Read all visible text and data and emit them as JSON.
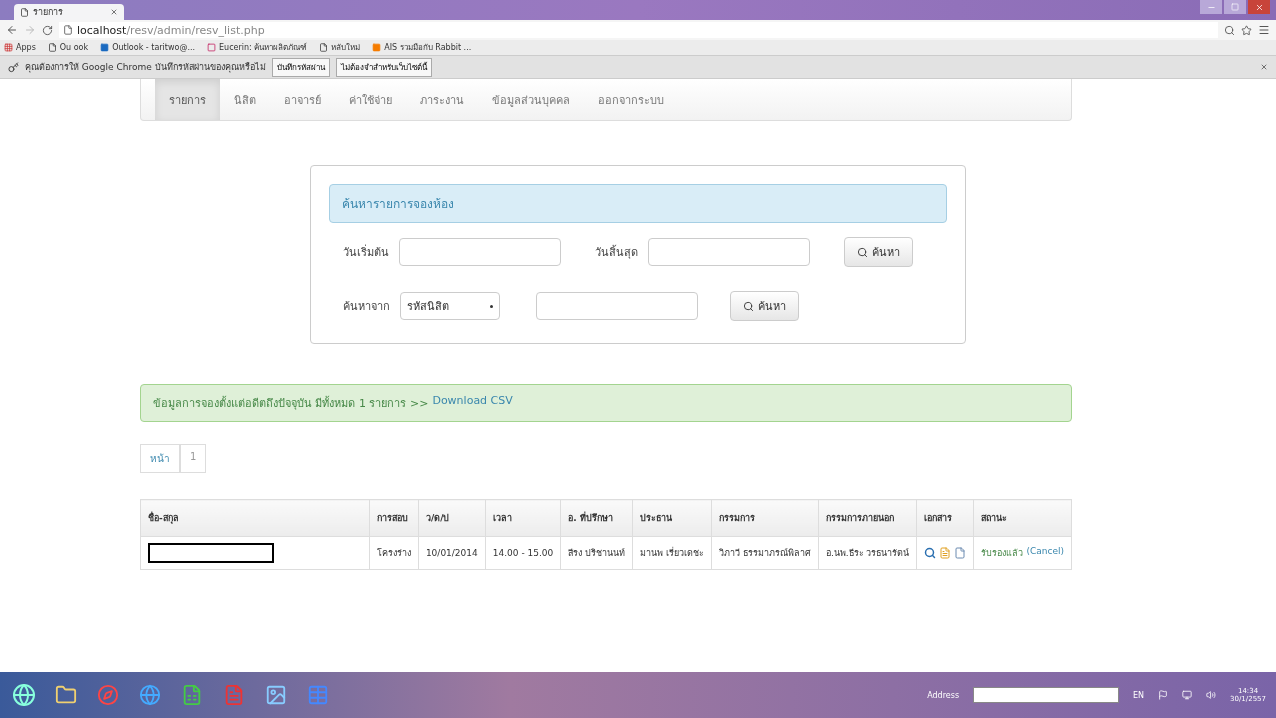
{
  "browser": {
    "tab_title": "รายการ",
    "url_host": "localhost",
    "url_path": "/resv/admin/resv_list.php",
    "bookmarks": [
      {
        "label": "Apps",
        "kind": "apps"
      },
      {
        "label": "Ou  ook",
        "kind": "page"
      },
      {
        "label": "Outlook - taritwo@...",
        "kind": "outlook"
      },
      {
        "label": "Eucerin: ค้นหาผลิตภัณฑ์",
        "kind": "brand"
      },
      {
        "label": "หลับใหม่",
        "kind": "page"
      },
      {
        "label": "AIS รวมมือกับ Rabbit ...",
        "kind": "blog"
      }
    ],
    "infobar": {
      "message": "คุณต้องการให้ Google Chrome บันทึกรหัสผ่านของคุณหรือไม่",
      "buttons": [
        "บันทึกรหัสผ่าน",
        "ไม่ต้องจำสำหรับเว็บไซต์นี้"
      ]
    }
  },
  "nav": [
    {
      "label": "รายการ",
      "selected": true
    },
    {
      "label": "นิสิต",
      "selected": false
    },
    {
      "label": "อาจารย์",
      "selected": false
    },
    {
      "label": "ค่าใช้จ่าย",
      "selected": false
    },
    {
      "label": "ภาระงาน",
      "selected": false
    },
    {
      "label": "ข้อมูลส่วนบุคคล",
      "selected": false
    },
    {
      "label": "ออกจากระบบ",
      "selected": false
    }
  ],
  "search": {
    "title": "ค้นหารายการจองห้อง",
    "start_label": "วันเริ่มต้น",
    "end_label": "วันสิ้นสุด",
    "search_button": "ค้นหา",
    "from_label": "ค้นหาจาก",
    "from_select": "รหัสนิสิต",
    "search_button_2": "ค้นหา"
  },
  "alert": {
    "text": "ข้อมูลการจองตั้งแต่อดีตถึงปัจจุบัน มีทั้งหมด 1 รายการ >>",
    "link": "Download CSV"
  },
  "pagination": {
    "label": "หน้า",
    "pages": [
      {
        "label": "1",
        "selected": true
      }
    ]
  },
  "table": {
    "columns": [
      "ชื่อ-สกุล",
      "การสอบ",
      "ว/ด/ป",
      "เวลา",
      "อ. ที่ปรึกษา",
      "ประธาน",
      "กรรมการ",
      "กรรมการภายนอก",
      "เอกสาร",
      "สถานะ"
    ],
    "rows": [
      {
        "name_redacted": true,
        "exam": "โครงร่าง",
        "date": "10/01/2014",
        "time": "14.00 - 15.00",
        "advisor": "สีรง ปริชานนท์",
        "chair": "มานพ เรี่ยวเดชะ",
        "committee": "วิภาวี ธรรมาภรณ์พิลาศ",
        "external": "อ.นพ.ธีระ วรธนารัตน์",
        "status": "รับรองแล้ว",
        "action": "(Cancel)"
      }
    ]
  },
  "taskbar": {
    "address_label": "Address",
    "lang": "EN",
    "time": "14:34",
    "date": "30/1/2557"
  }
}
